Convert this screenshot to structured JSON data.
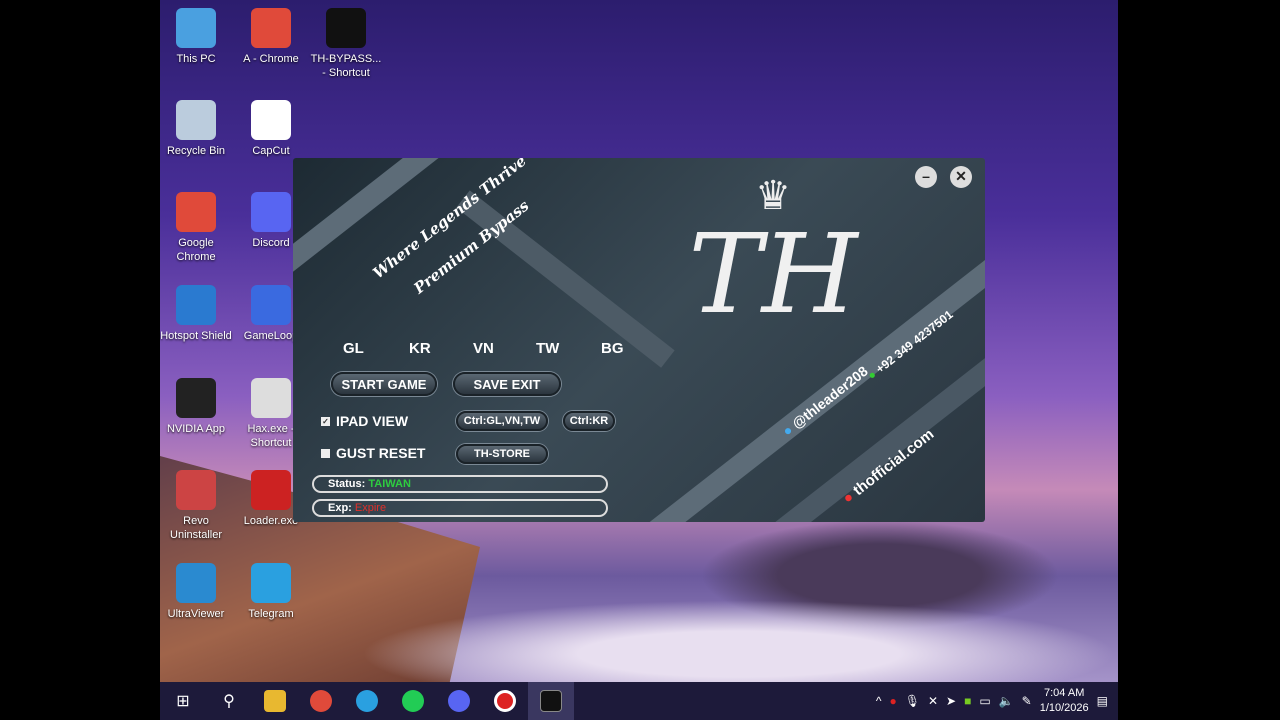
{
  "desktop": {
    "icons": [
      {
        "label": "This PC",
        "color": "#4aa0e0"
      },
      {
        "label": "A - Chrome",
        "color": "#e04a3a"
      },
      {
        "label": "TH-BYPASS... - Shortcut",
        "color": "#111"
      },
      {
        "label": "Recycle Bin",
        "color": "#bcd"
      },
      {
        "label": "CapCut",
        "color": "#fff"
      },
      {
        "label": "Google Chrome",
        "color": "#e04a3a"
      },
      {
        "label": "Discord",
        "color": "#5865f2"
      },
      {
        "label": "Hotspot Shield",
        "color": "#2a7ad0"
      },
      {
        "label": "GameLoop",
        "color": "#3a6ae0"
      },
      {
        "label": "NVIDIA App",
        "color": "#222"
      },
      {
        "label": "Hax.exe - Shortcut",
        "color": "#ddd"
      },
      {
        "label": "Revo Uninstaller",
        "color": "#c44"
      },
      {
        "label": "Loader.exe",
        "color": "#c22"
      },
      {
        "label": "UltraViewer",
        "color": "#2a8ad0"
      },
      {
        "label": "Telegram",
        "color": "#2aa0e0"
      }
    ]
  },
  "app": {
    "tagline1": "Where Legends Thrive",
    "tagline2": "Premium Bypass",
    "logo": "TH",
    "regions": [
      "GL",
      "KR",
      "VN",
      "TW",
      "BG"
    ],
    "start_game": "START GAME",
    "save_exit": "SAVE EXIT",
    "ipad_view": "IPAD VIEW",
    "ipad_checked": true,
    "gust_reset": "GUST RESET",
    "gust_checked": false,
    "ctrl_gl": "Ctrl:GL,VN,TW",
    "ctrl_kr": "Ctrl:KR",
    "store": "TH-STORE",
    "status_label": "Status:",
    "status_value": "TAIWAN",
    "exp_label": "Exp:",
    "exp_value": "Expire",
    "phone": "+92 349 4237501",
    "telegram": "@thleader208",
    "website": "thofficial.com",
    "status_color": "#2ecc40",
    "exp_color": "#e0302a"
  },
  "taskbar": {
    "time": "7:04 AM",
    "date": "1/10/2026"
  }
}
